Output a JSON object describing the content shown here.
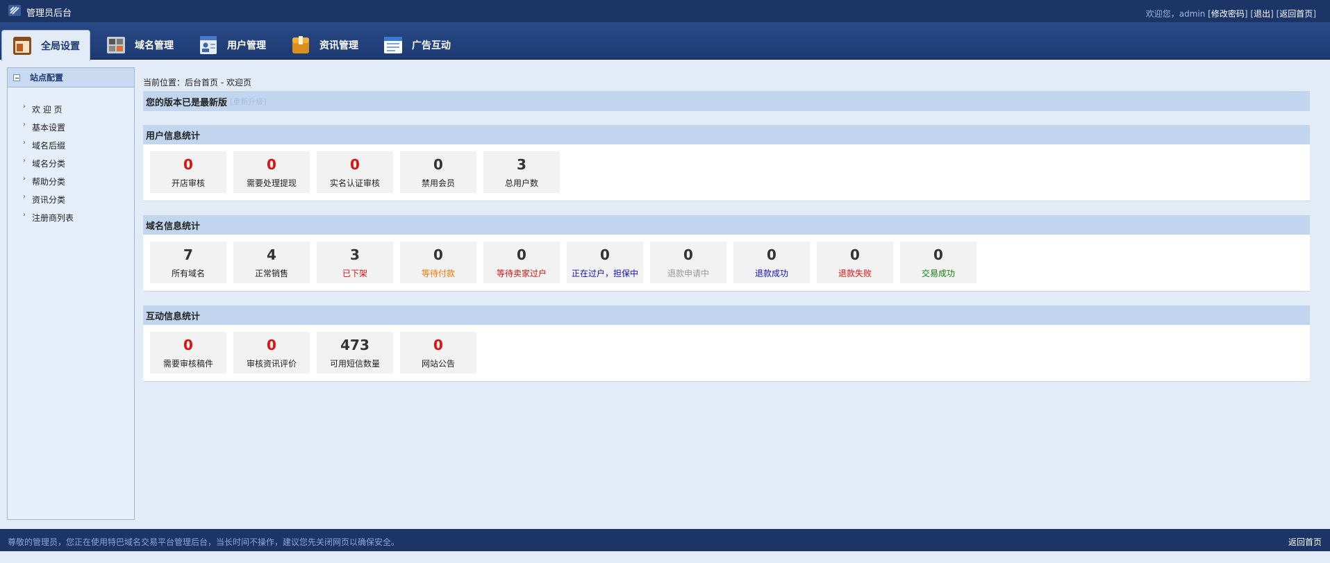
{
  "topbar": {
    "title": "管理员后台",
    "welcome": "欢迎您，admin",
    "change_password": "修改密码",
    "logout": "退出",
    "home": "返回首页"
  },
  "nav": {
    "tabs": [
      {
        "label": "全局设置",
        "icon": "settings-icon"
      },
      {
        "label": "域名管理",
        "icon": "domain-grid-icon"
      },
      {
        "label": "用户管理",
        "icon": "user-card-icon"
      },
      {
        "label": "资讯管理",
        "icon": "news-box-icon"
      },
      {
        "label": "广告互动",
        "icon": "ad-window-icon"
      }
    ],
    "active": 0
  },
  "sidebar": {
    "title": "站点配置",
    "items": [
      "欢 迎 页",
      "基本设置",
      "域名后缀",
      "域名分类",
      "帮助分类",
      "资讯分类",
      "注册商列表"
    ]
  },
  "breadcrumb": "当前位置：后台首页 - 欢迎页",
  "version": {
    "status": "您的版本已是最新版",
    "upgrade": "[重新升级]"
  },
  "sections": {
    "user": {
      "title": "用户信息统计",
      "stats": [
        {
          "value": "0",
          "label": "开店审核",
          "value_color": "#e01010",
          "label_color": "#222222"
        },
        {
          "value": "0",
          "label": "需要处理提现",
          "value_color": "#e01010",
          "label_color": "#222222"
        },
        {
          "value": "0",
          "label": "实名认证审核",
          "value_color": "#e01010",
          "label_color": "#222222"
        },
        {
          "value": "0",
          "label": "禁用会员",
          "value_color": "#333333",
          "label_color": "#222222"
        },
        {
          "value": "3",
          "label": "总用户数",
          "value_color": "#333333",
          "label_color": "#222222"
        }
      ]
    },
    "domain": {
      "title": "域名信息统计",
      "stats": [
        {
          "value": "7",
          "label": "所有域名",
          "value_color": "#333333",
          "label_color": "#222222"
        },
        {
          "value": "4",
          "label": "正常销售",
          "value_color": "#333333",
          "label_color": "#222222"
        },
        {
          "value": "3",
          "label": "已下架",
          "value_color": "#333333",
          "label_color": "#e01010"
        },
        {
          "value": "0",
          "label": "等待付款",
          "value_color": "#333333",
          "label_color": "#f07800"
        },
        {
          "value": "0",
          "label": "等待卖家过户",
          "value_color": "#333333",
          "label_color": "#e01010"
        },
        {
          "value": "0",
          "label": "正在过户，担保中",
          "value_color": "#333333",
          "label_color": "#1010c0"
        },
        {
          "value": "0",
          "label": "退款申请中",
          "value_color": "#333333",
          "label_color": "#999999"
        },
        {
          "value": "0",
          "label": "退款成功",
          "value_color": "#333333",
          "label_color": "#1010c0"
        },
        {
          "value": "0",
          "label": "退款失败",
          "value_color": "#333333",
          "label_color": "#e01010"
        },
        {
          "value": "0",
          "label": "交易成功",
          "value_color": "#333333",
          "label_color": "#108010"
        }
      ]
    },
    "interact": {
      "title": "互动信息统计",
      "stats": [
        {
          "value": "0",
          "label": "需要审核稿件",
          "value_color": "#e01010",
          "label_color": "#222222"
        },
        {
          "value": "0",
          "label": "审核资讯评价",
          "value_color": "#e01010",
          "label_color": "#222222"
        },
        {
          "value": "473",
          "label": "可用短信数量",
          "value_color": "#333333",
          "label_color": "#222222"
        },
        {
          "value": "0",
          "label": "网站公告",
          "value_color": "#e01010",
          "label_color": "#222222"
        }
      ]
    }
  },
  "footer": {
    "message": "尊敬的管理员，您正在使用特巴域名交易平台管理后台，当长时间不操作，建议您先关闭网页以确保安全。",
    "home": "返回首页"
  }
}
